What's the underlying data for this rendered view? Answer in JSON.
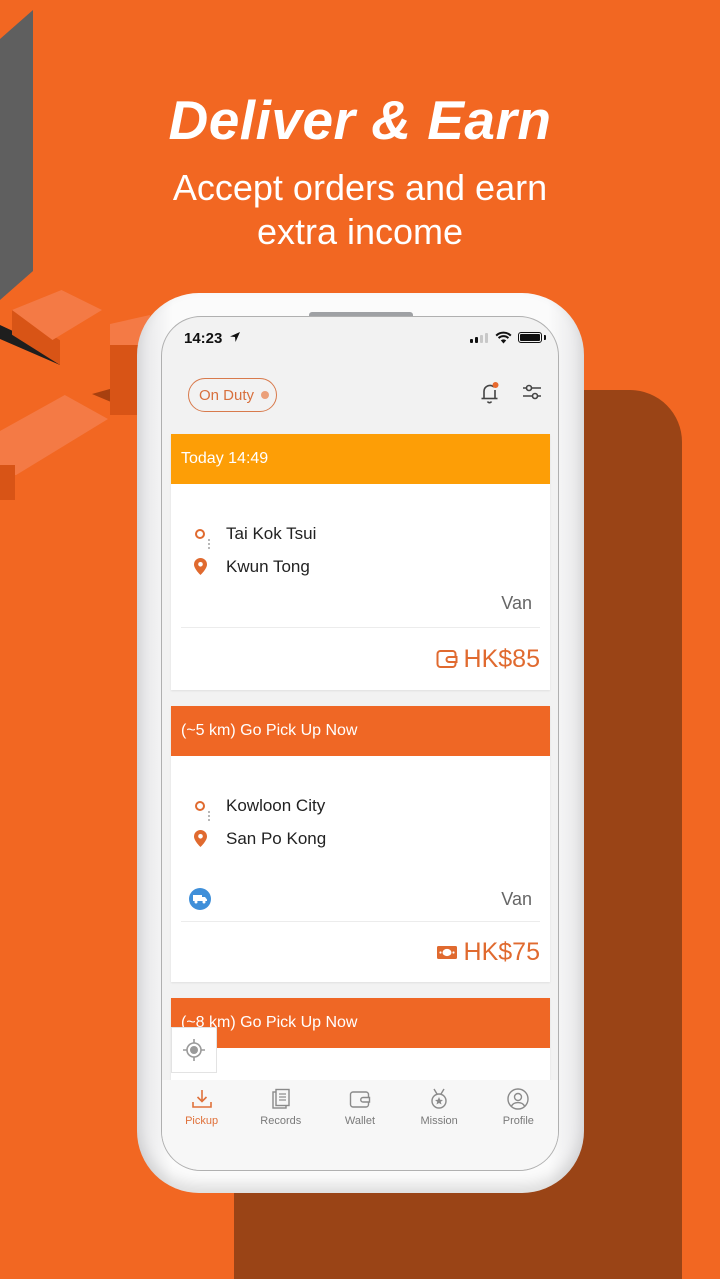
{
  "hero": {
    "title": "Deliver & Earn",
    "subtitle_line1": "Accept orders and earn",
    "subtitle_line2": "extra income"
  },
  "colors": {
    "background": "#f26722",
    "accent": "#e06a2f",
    "scheduled_header": "#fd9e06",
    "immediate_header": "#ef6725",
    "dark_panel": "#9a4416"
  },
  "status_bar": {
    "time": "14:23",
    "location_icon": "location-arrow-icon",
    "signal_icon": "cellular-signal-icon",
    "wifi_icon": "wifi-icon",
    "battery_icon": "battery-icon"
  },
  "header": {
    "duty_status": "On Duty",
    "notification_icon": "bell-icon",
    "filter_icon": "sliders-icon"
  },
  "orders": [
    {
      "header": "Today 14:49",
      "header_type": "scheduled",
      "pickup": "Tai Kok Tsui",
      "dropoff": "Kwun Tong",
      "vehicle": "Van",
      "show_vehicle_icon": false,
      "payment_icon": "wallet-icon",
      "price": "HK$85"
    },
    {
      "header": "(~5 km) Go Pick Up Now",
      "header_type": "immediate",
      "pickup": "Kowloon City",
      "dropoff": "San Po Kong",
      "vehicle": "Van",
      "show_vehicle_icon": true,
      "payment_icon": "cash-icon",
      "price": "HK$75"
    },
    {
      "header": "(~8 km) Go Pick Up Now",
      "header_type": "immediate"
    }
  ],
  "tabbar": {
    "items": [
      {
        "label": "Pickup",
        "icon": "download-tray-icon",
        "active": true
      },
      {
        "label": "Records",
        "icon": "document-icon",
        "active": false
      },
      {
        "label": "Wallet",
        "icon": "wallet-icon",
        "active": false
      },
      {
        "label": "Mission",
        "icon": "medal-icon",
        "active": false
      },
      {
        "label": "Profile",
        "icon": "user-circle-icon",
        "active": false
      }
    ]
  }
}
